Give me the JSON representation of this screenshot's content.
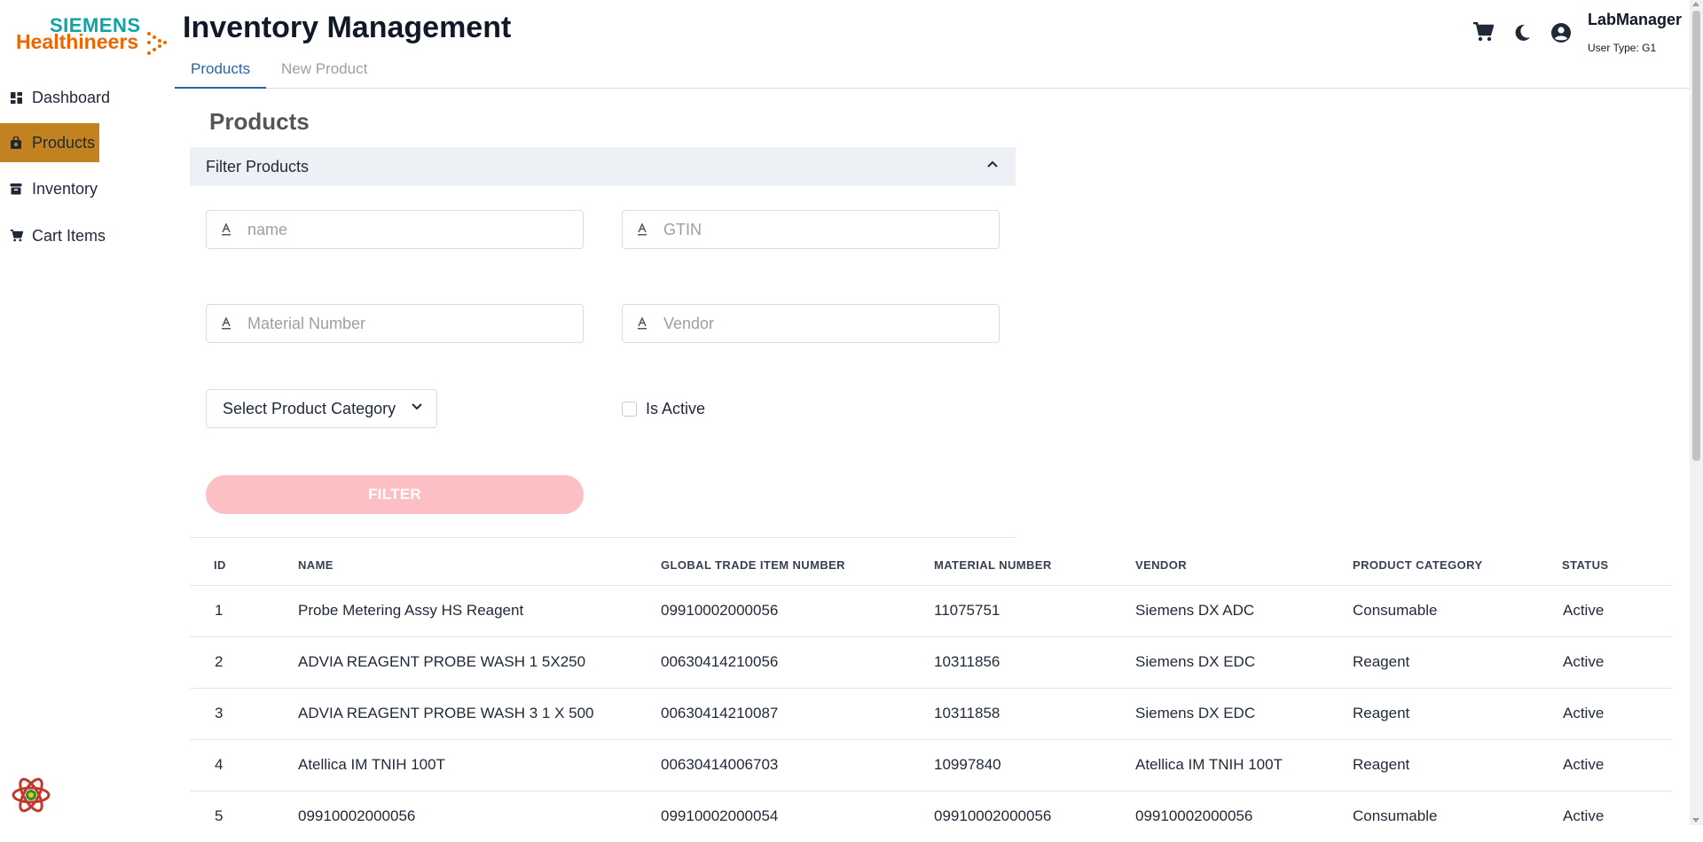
{
  "brand": {
    "line1": "SIEMENS",
    "line2": "Healthineers"
  },
  "colors": {
    "accent": "#2b63a8",
    "active_nav": "#c1821f",
    "filter_button": "#fcbfc3",
    "brand_teal": "#0fa3a3",
    "brand_orange": "#ec6602"
  },
  "sidebar": {
    "items": [
      {
        "label": "Dashboard",
        "icon": "dashboard-icon"
      },
      {
        "label": "Products",
        "icon": "bag-icon",
        "active": true
      },
      {
        "label": "Inventory",
        "icon": "archive-icon"
      },
      {
        "label": "Cart Items",
        "icon": "cart-icon"
      }
    ]
  },
  "header": {
    "title": "Inventory Management",
    "tabs": [
      {
        "label": "Products",
        "active": true
      },
      {
        "label": "New Product",
        "active": false
      }
    ],
    "icons": [
      "cart-icon",
      "dark-mode-icon",
      "account-icon"
    ],
    "user": {
      "name": "LabManager",
      "type": "User Type: G1"
    }
  },
  "main": {
    "title": "Products",
    "filter": {
      "header": "Filter Products",
      "name_placeholder": "name",
      "gtin_placeholder": "GTIN",
      "material_placeholder": "Material Number",
      "vendor_placeholder": "Vendor",
      "category_select": "Select Product Category",
      "active_label": "Is Active",
      "active_checked": false,
      "button": "FILTER"
    },
    "table": {
      "columns": [
        "ID",
        "NAME",
        "GLOBAL TRADE ITEM NUMBER",
        "MATERIAL NUMBER",
        "VENDOR",
        "PRODUCT CATEGORY",
        "STATUS"
      ],
      "rows": [
        [
          "1",
          "Probe Metering Assy HS Reagent",
          "09910002000056",
          "11075751",
          "Siemens DX ADC",
          "Consumable",
          "Active"
        ],
        [
          "2",
          "ADVIA REAGENT PROBE WASH 1 5X250",
          "00630414210056",
          "10311856",
          "Siemens DX EDC",
          "Reagent",
          "Active"
        ],
        [
          "3",
          "ADVIA REAGENT PROBE WASH 3 1 X 500",
          "00630414210087",
          "10311858",
          "Siemens DX EDC",
          "Reagent",
          "Active"
        ],
        [
          "4",
          "Atellica IM TNIH 100T",
          "00630414006703",
          "10997840",
          "Atellica IM TNIH 100T",
          "Reagent",
          "Active"
        ],
        [
          "5",
          "09910002000056",
          "09910002000054",
          "09910002000056",
          "09910002000056",
          "Consumable",
          "Active"
        ]
      ]
    }
  }
}
